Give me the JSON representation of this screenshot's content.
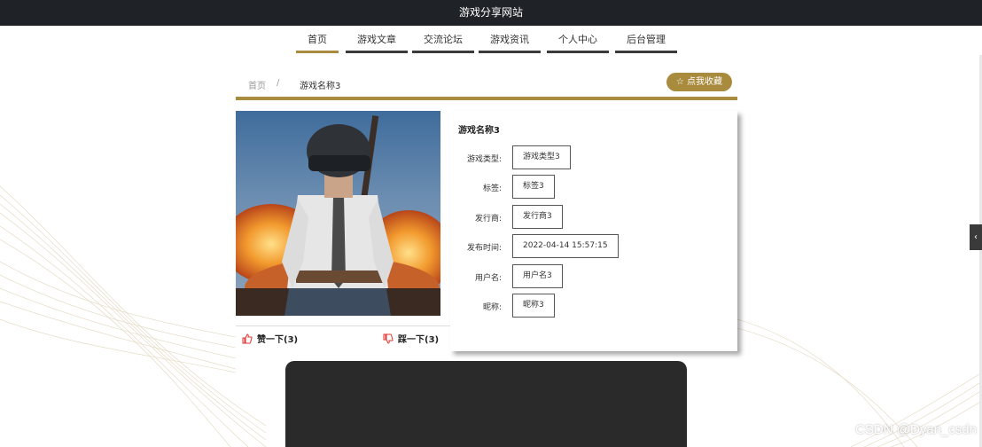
{
  "site": {
    "title": "游戏分享网站"
  },
  "nav": {
    "items": [
      {
        "label": "首页"
      },
      {
        "label": "游戏文章"
      },
      {
        "label": "交流论坛"
      },
      {
        "label": "游戏资讯"
      },
      {
        "label": "个人中心"
      },
      {
        "label": "后台管理"
      }
    ],
    "active_index": 0
  },
  "breadcrumb": {
    "home": "首页",
    "separator": "/",
    "current": "游戏名称3"
  },
  "favorite_button": {
    "label": "☆ 点我收藏"
  },
  "game": {
    "name": "游戏名称3",
    "fields": [
      {
        "label": "游戏类型:",
        "value": "游戏类型3"
      },
      {
        "label": "标签:",
        "value": "标签3"
      },
      {
        "label": "发行商:",
        "value": "发行商3"
      },
      {
        "label": "发布时间:",
        "value": "2022-04-14 15:57:15"
      },
      {
        "label": "用户名:",
        "value": "用户名3"
      },
      {
        "label": "昵称:",
        "value": "昵称3"
      }
    ]
  },
  "votes": {
    "like_label": "赞一下(3)",
    "dislike_label": "踩一下(3)"
  },
  "side_toggle": {
    "label": "‹"
  },
  "watermark": {
    "text": "CSDN @Dyan_csdn"
  },
  "colors": {
    "accent": "#a98b3e",
    "topbar": "#1f2227",
    "nav_bar": "#3b3b3b",
    "like_icon": "#e0322f",
    "dark_panel": "#2a2a2b"
  }
}
